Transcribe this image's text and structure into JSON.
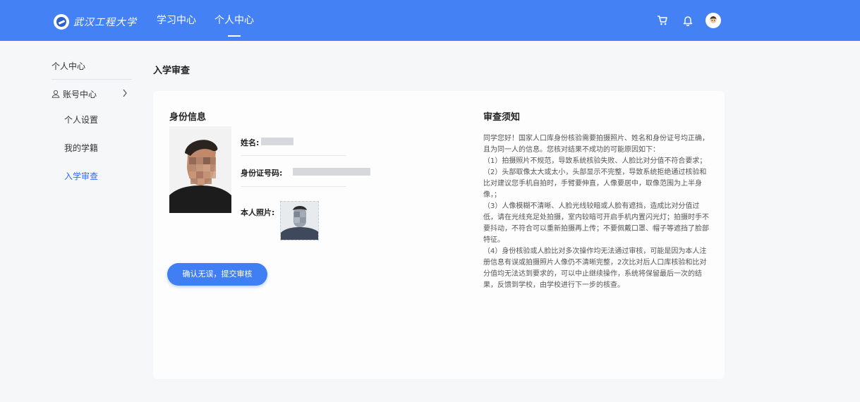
{
  "header": {
    "logo_text": "武汉工程大学",
    "nav": [
      {
        "label": "学习中心",
        "active": false
      },
      {
        "label": "个人中心",
        "active": true
      }
    ],
    "icons": [
      "cart-icon",
      "bell-icon",
      "avatar-icon"
    ],
    "accent_color": "#4381f5"
  },
  "sidebar": {
    "title": "个人中心",
    "group_label": "账号中心",
    "items": [
      {
        "label": "个人设置",
        "active": false
      },
      {
        "label": "我的学籍",
        "active": false
      },
      {
        "label": "入学审查",
        "active": true
      }
    ]
  },
  "page": {
    "title": "入学审查"
  },
  "identity": {
    "section_title": "身份信息",
    "name_label": "姓名:",
    "id_label": "身份证号码:",
    "photo_label": "本人照片:",
    "submit_label": "确认无误，提交审核"
  },
  "notice": {
    "title": "审查须知",
    "paragraphs": [
      "同学您好！国家人口库身份核验需要拍摄照片、姓名和身份证号均正确，且为同一人的信息。您核对结果不成功的可能原因如下：",
      "（1）拍摄照片不规范，导致系统核验失败、人脸比对分值不符合要求；",
      "（2）头部取像太大或太小，头部显示不完整，导致系统拒绝通过核验和比对建议您手机自拍时，手臂要伸直，人像要居中，取像范围为上半身像，；",
      "（3）人像模糊不清晰、人脸光线较暗或人脸有遮挡，造成比对分值过低，请在光线充足处拍摄，室内较暗可开启手机内置闪光灯；拍摄时手不要抖动，不符合可以重新拍摄再上传；不要佩戴口罩、帽子等遮挡了脸部特征。",
      "（4）身份核验或人脸比对多次操作均无法通过审核，可能是因为本人注册信息有误或拍摄照片人像仍不清晰完整，2次比对后人口库核验和比对分值均无法达到要求的，可以中止继续操作，系统将保留最后一次的结果，反馈到学校，由学校进行下一步的核查。"
    ]
  }
}
